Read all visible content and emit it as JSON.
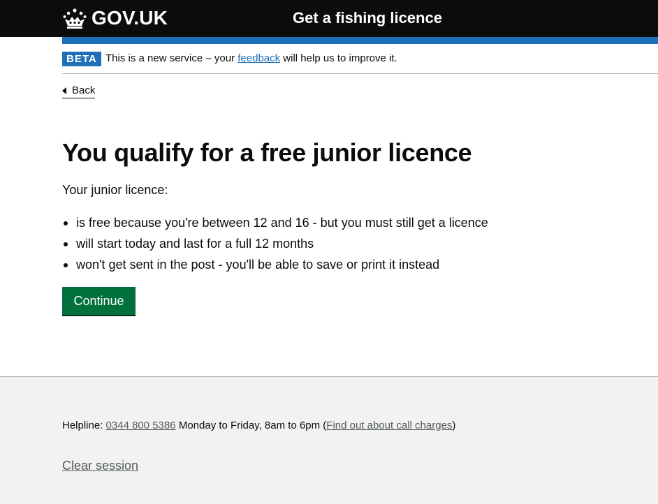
{
  "header": {
    "logo_text": "GOV.UK",
    "service_name": "Get a fishing licence"
  },
  "phase_banner": {
    "tag": "BETA",
    "text_before": "This is a new service – your ",
    "link_text": "feedback",
    "text_after": " will help us to improve it."
  },
  "back_link": {
    "label": "Back"
  },
  "main": {
    "heading": "You qualify for a free junior licence",
    "intro": "Your junior licence:",
    "bullets": [
      "is free because you're between 12 and 16 - but you must still get a licence",
      "will start today and last for a full 12 months",
      "won't get sent in the post - you'll be able to save or print it instead"
    ],
    "continue_label": "Continue"
  },
  "footer": {
    "helpline_label": "Helpline: ",
    "helpline_number": "0344 800 5386",
    "helpline_hours": " Monday to Friday, 8am to 6pm (",
    "call_charges_link": "Find out about call charges",
    "helpline_close": ")",
    "clear_session": "Clear session"
  },
  "colors": {
    "header_bg": "#0b0c0c",
    "brand_blue": "#1d70b8",
    "button_green": "#00703c",
    "footer_bg": "#f3f2f1"
  },
  "icons": [
    "crown-icon",
    "chevron-left-icon"
  ]
}
